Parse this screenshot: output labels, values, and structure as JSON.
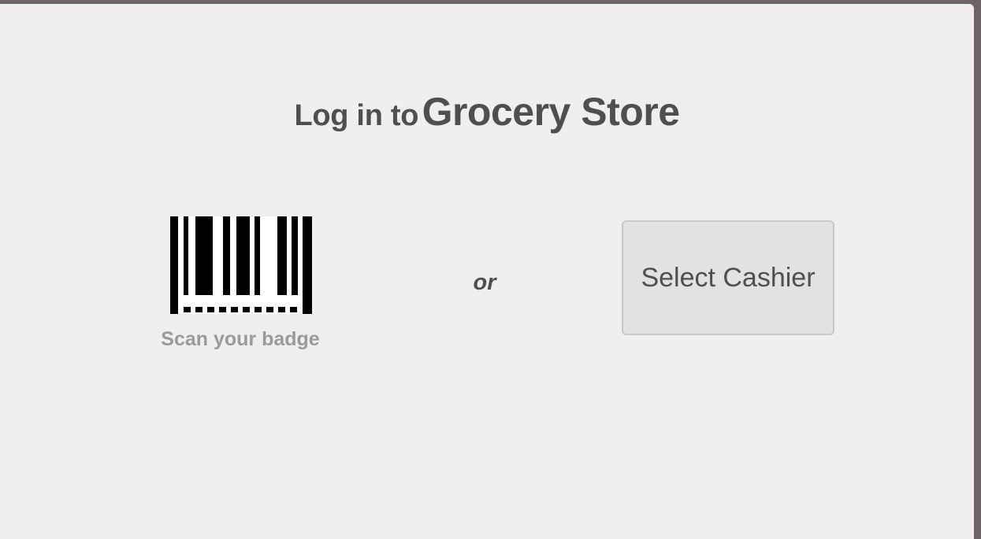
{
  "login": {
    "title_prefix": "Log in to",
    "store_name": "Grocery Store",
    "scan_label": "Scan your badge",
    "separator": "or",
    "select_cashier_label": "Select Cashier",
    "barcode_icon": "barcode-icon"
  },
  "colors": {
    "backdrop": "#6e6468",
    "card_background": "#f0eeef",
    "title_text": "#4f4f4f",
    "muted_text": "#9a9a9a",
    "button_background": "#e2e2e2",
    "button_border": "#c9c7c8"
  }
}
